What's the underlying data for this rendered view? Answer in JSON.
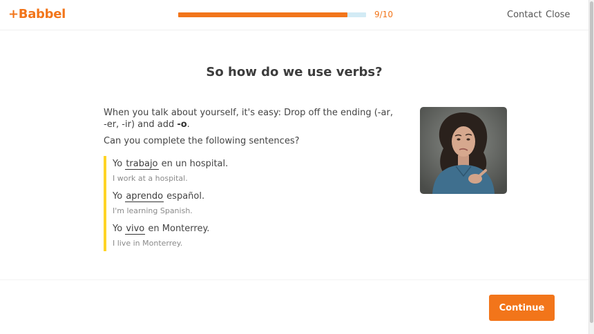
{
  "header": {
    "logo": "+Babbel",
    "progress": {
      "current": 9,
      "total": 10,
      "label": "9/10",
      "fill_fraction": 0.9
    },
    "links": {
      "contact": "Contact",
      "close": "Close"
    }
  },
  "lesson": {
    "title": "So how do we use verbs?",
    "intro_before": "When you talk about yourself, it's easy: Drop off the ending (-ar, -er, -ir) and add ",
    "intro_bold": "-o",
    "intro_after": ".",
    "question": "Can you complete the following sentences?",
    "examples": [
      {
        "pre": "Yo ",
        "word": "trabajo",
        "post": " en un hospital.",
        "translation": "I work at a hospital."
      },
      {
        "pre": "Yo ",
        "word": "aprendo",
        "post": " español.",
        "translation": "I'm learning Spanish."
      },
      {
        "pre": "Yo ",
        "word": "vivo",
        "post": " en Monterrey.",
        "translation": "I live in Monterrey."
      }
    ]
  },
  "footer": {
    "continue_label": "Continue"
  },
  "colors": {
    "brand_orange": "#f2751a",
    "highlight_yellow": "#ffd426",
    "progress_track": "#d2ebf5"
  }
}
